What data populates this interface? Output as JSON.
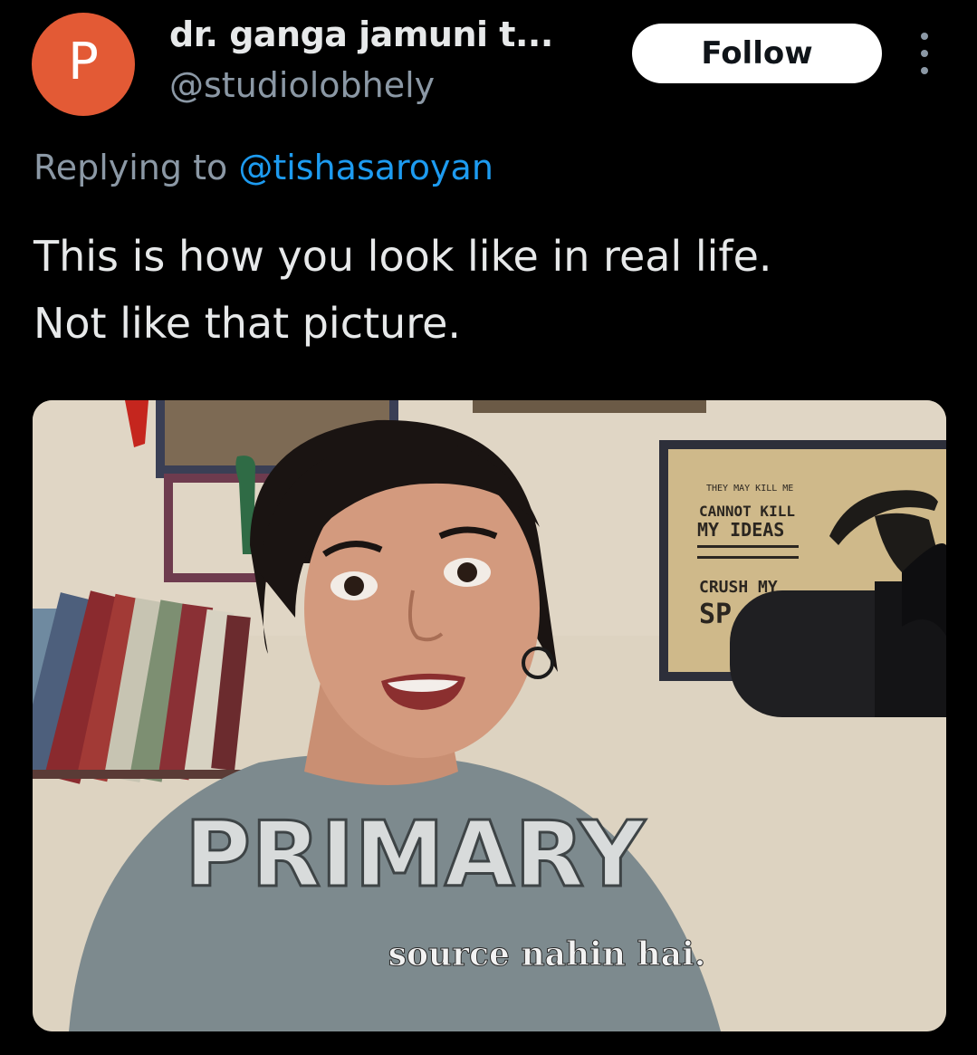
{
  "author": {
    "avatar_letter": "P",
    "avatar_color": "#e35a35",
    "display_name": "dr. ganga jamuni t...",
    "handle": "@studiolobhely"
  },
  "actions": {
    "follow_label": "Follow",
    "more_icon": "more-vertical-icon"
  },
  "reply": {
    "prefix": "Replying to ",
    "target_handle": "@tishasaroyan"
  },
  "tweet": {
    "lines": [
      "This is how you look like in real life.",
      "Not like that picture."
    ]
  },
  "media": {
    "caption_primary": "PRIMARY",
    "caption_sub": "source nahin hai.",
    "poster_lines": [
      "THEY MAY KILL ME",
      "CANNOT KILL",
      "MY IDEAS",
      "CRUSH MY",
      "SP"
    ]
  },
  "colors": {
    "background": "#000000",
    "text_primary": "#e7e9ea",
    "text_secondary": "#8b98a5",
    "link": "#1d9bf0",
    "follow_bg": "#ffffff"
  }
}
